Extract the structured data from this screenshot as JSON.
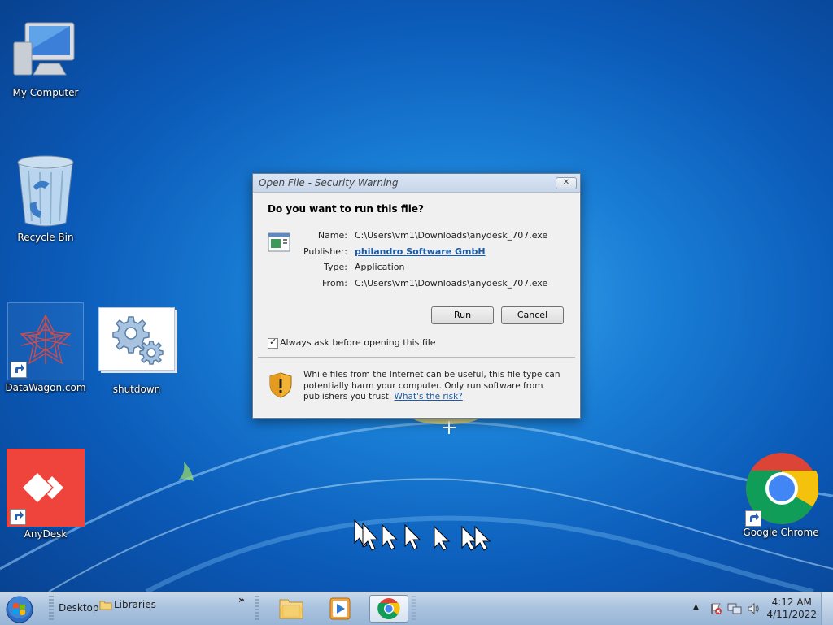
{
  "desktop": {
    "icons": {
      "my_computer": "My Computer",
      "recycle_bin": "Recycle Bin",
      "datawagon": "DataWagon.com",
      "shutdown": "shutdown",
      "anydesk": "AnyDesk",
      "chrome": "Google Chrome"
    }
  },
  "dialog": {
    "title": "Open File - Security Warning",
    "question": "Do you want to run this file?",
    "fields": {
      "name_label": "Name:",
      "name_value": "C:\\Users\\vm1\\Downloads\\anydesk_707.exe",
      "publisher_label": "Publisher:",
      "publisher_value": "philandro Software GmbH",
      "type_label": "Type:",
      "type_value": "Application",
      "from_label": "From:",
      "from_value": "C:\\Users\\vm1\\Downloads\\anydesk_707.exe"
    },
    "run_label": "Run",
    "cancel_label": "Cancel",
    "checkbox_label": "Always ask before opening this file",
    "checkbox_checked": true,
    "warning_text": "While files from the Internet can be useful, this file type can potentially harm your computer. Only run software from publishers you trust. ",
    "risk_link": "What's the risk?",
    "close_glyph": "✕"
  },
  "taskbar": {
    "desktop_label": "Desktop",
    "libraries_label": "Libraries",
    "overflow_glyph": "»",
    "tray_arrow_glyph": "▲",
    "time": "4:12 AM",
    "date": "4/11/2022"
  },
  "colors": {
    "anydesk_red": "#ef443b",
    "link_blue": "#1a5aa8",
    "desktop_blue": "#1a7fd6"
  }
}
